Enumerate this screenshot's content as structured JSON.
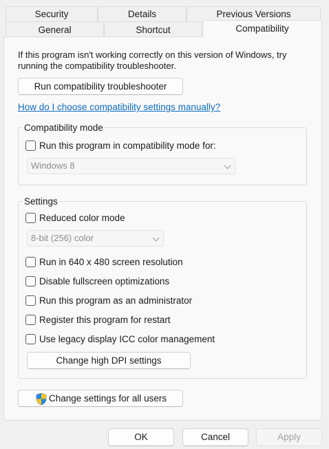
{
  "tabs": {
    "row1": [
      "Security",
      "Details",
      "Previous Versions"
    ],
    "row2": [
      "General",
      "Shortcut",
      "Compatibility"
    ],
    "active": "Compatibility"
  },
  "intro_text": {
    "line1": "If this program isn't working correctly on this version of Windows, try",
    "line2": "running the compatibility troubleshooter."
  },
  "troubleshooter_button": "Run compatibility troubleshooter",
  "help_link": "How do I choose compatibility settings manually?",
  "compat_mode": {
    "group_label": "Compatibility mode",
    "checkbox_label": "Run this program in compatibility mode for:",
    "checked": false,
    "os_select": "Windows 8"
  },
  "settings": {
    "group_label": "Settings",
    "reduced_color": {
      "label": "Reduced color mode",
      "checked": false
    },
    "color_select": "8-bit (256) color",
    "checkboxes": [
      {
        "label": "Run in 640 x 480 screen resolution",
        "checked": false
      },
      {
        "label": "Disable fullscreen optimizations",
        "checked": false
      },
      {
        "label": "Run this program as an administrator",
        "checked": false
      },
      {
        "label": "Register this program for restart",
        "checked": false
      },
      {
        "label": "Use legacy display ICC color management",
        "checked": false
      }
    ],
    "dpi_button": "Change high DPI settings"
  },
  "all_users_button": "Change settings for all users",
  "footer": {
    "ok": "OK",
    "cancel": "Cancel",
    "apply": "Apply"
  }
}
